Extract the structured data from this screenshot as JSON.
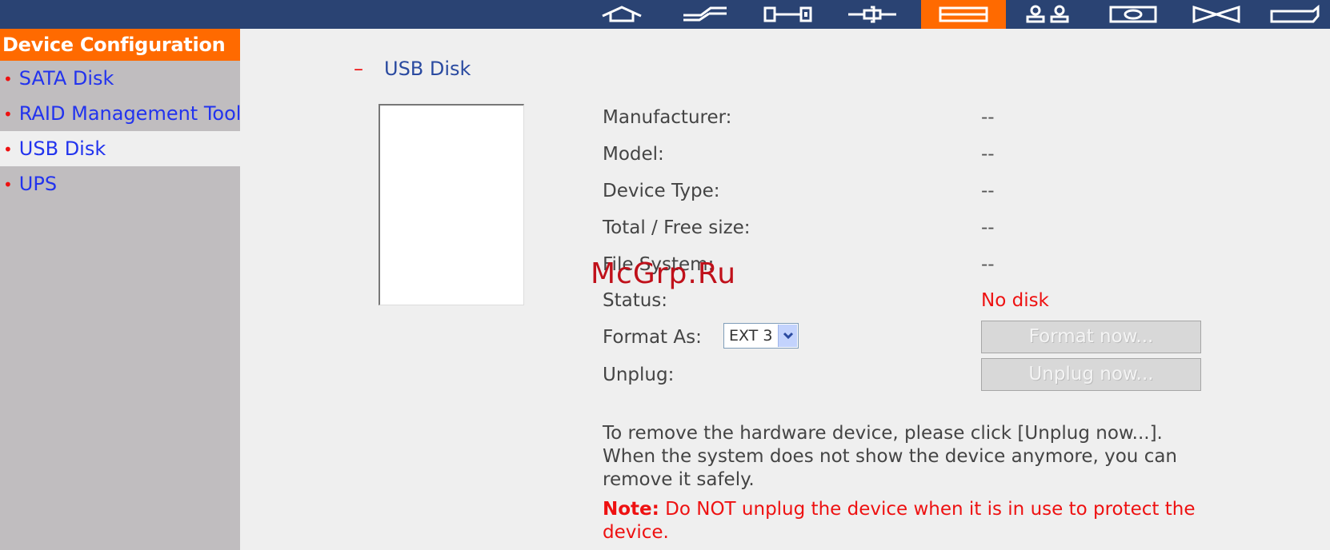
{
  "colors": {
    "topbar": "#2a4373",
    "accent": "#ff6a00",
    "link": "#2233ee",
    "alert": "#ee1111"
  },
  "topnav": {
    "icons": [
      "home-icon",
      "flash-icon",
      "network-icon",
      "plug-icon",
      "disk-icon",
      "users-icon",
      "monitor-icon",
      "mail-icon",
      "folder-icon"
    ],
    "active_index": 4
  },
  "sidebar": {
    "title": "Device Configuration",
    "items": [
      {
        "label": "SATA Disk"
      },
      {
        "label": "RAID Management Tool"
      },
      {
        "label": "USB Disk"
      },
      {
        "label": "UPS"
      }
    ],
    "selected_index": 2
  },
  "main": {
    "section_dash": "–",
    "section_title": "USB Disk",
    "rows": [
      {
        "label": "Manufacturer:",
        "value": "--"
      },
      {
        "label": "Model:",
        "value": "--"
      },
      {
        "label": "Device Type:",
        "value": "--"
      },
      {
        "label": "Total / Free size:",
        "value": "--"
      },
      {
        "label": "File System:",
        "value": "--"
      },
      {
        "label": "Status:",
        "value": "No disk"
      }
    ],
    "format_label": "Format As:",
    "format_selected": "EXT 3",
    "format_button": "Format now...",
    "unplug_label": "Unplug:",
    "unplug_button": "Unplug now...",
    "info_text": "To remove the hardware device, please click [Unplug now...]. When the system does not show the device anymore, you can remove it safely.",
    "note_label": "Note:",
    "note_text": " Do NOT unplug the device when it is in use to protect the device."
  },
  "watermark": "McGrp.Ru"
}
